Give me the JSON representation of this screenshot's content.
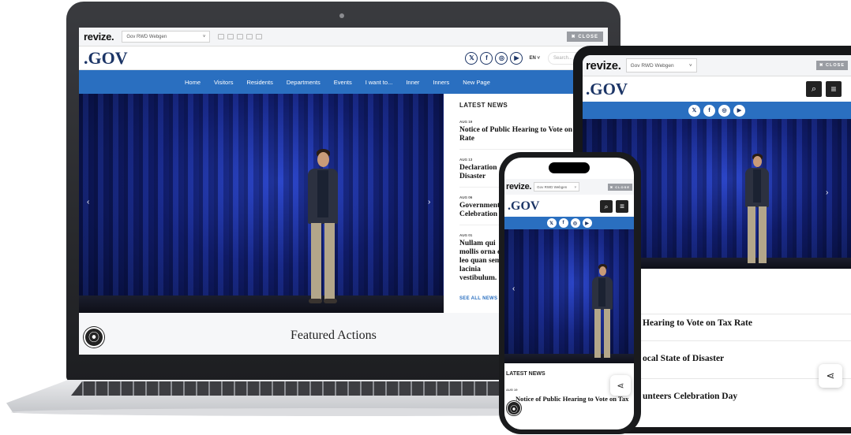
{
  "desktop": {
    "revize_logo": "revize.",
    "site_select": "Gov RWD Webgen",
    "close_label": "✖ CLOSE",
    "gov_logo": ".GOV",
    "lang": "EN ˅",
    "search_placeholder": "Search...",
    "social": [
      "𝕏",
      "f",
      "◎",
      "▶"
    ],
    "nav": [
      "Home",
      "Visitors",
      "Residents",
      "Departments",
      "Events",
      "I want to...",
      "Inner",
      "Inners",
      "New Page"
    ],
    "hero_prev": "‹",
    "hero_next": "›",
    "news_heading": "LATEST NEWS",
    "news": [
      {
        "date": "AUG 19",
        "title": "Notice of Public Hearing to Vote on Tax Rate"
      },
      {
        "date": "AUG 13",
        "title": "Declaration Disaster"
      },
      {
        "date": "AUG 06",
        "title": "Government Celebration"
      },
      {
        "date": "AUG 01",
        "title": "Nullam qui mollis orna eu leo quan sem lacinia vestibulum."
      }
    ],
    "see_all": "SEE ALL NEWS",
    "featured_title": "Featured Actions",
    "a11y_icon": "⦿"
  },
  "tablet": {
    "revize_logo": "revize.",
    "site_select": "Gov RWD Webgen",
    "close_label": "✖ CLOSE",
    "gov_logo": ".GOV",
    "search_btn": "⌕",
    "menu_btn": "≡",
    "social": [
      "𝕏",
      "f",
      "◎",
      "▶"
    ],
    "hero_next": "›",
    "news": [
      "Hearing to Vote on Tax Rate",
      "ocal State of Disaster",
      "unteers Celebration Day"
    ],
    "share_icon": "⋖"
  },
  "phone": {
    "revize_logo": "revize.",
    "site_select": "Gov RWD Webgen",
    "close_label": "✖ CLOSE",
    "gov_logo": ".GOV",
    "search_btn": "⌕",
    "menu_btn": "≡",
    "social": [
      "𝕏",
      "f",
      "◎",
      "▶"
    ],
    "hero_prev": "‹",
    "news_heading": "LATEST NEWS",
    "news_date": "AUG 19",
    "news_title": "Notice of Public Hearing to Vote on Tax",
    "share_icon": "⋖",
    "a11y_icon": "⦿"
  }
}
